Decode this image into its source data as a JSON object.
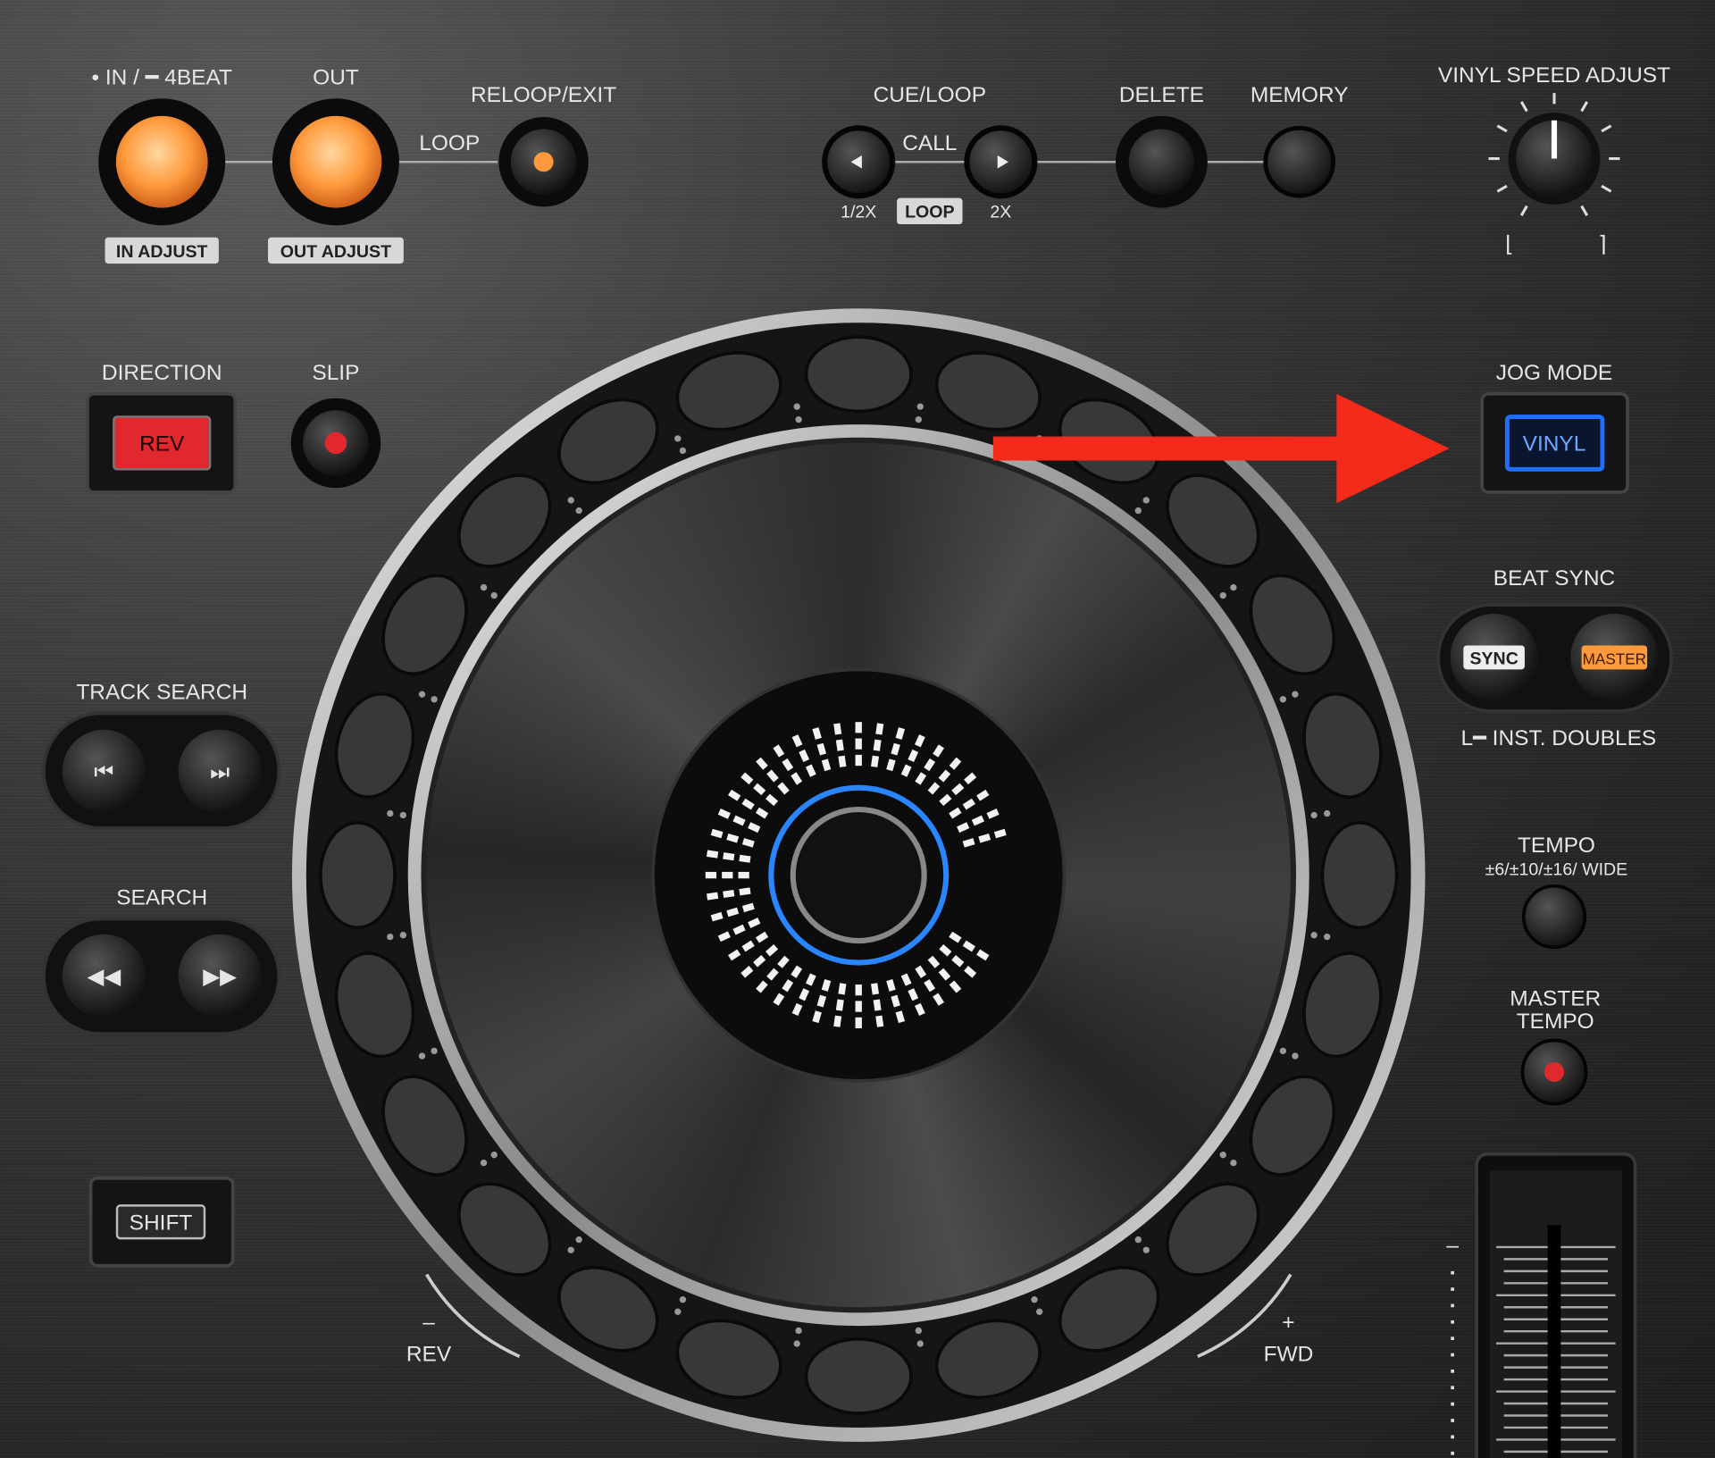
{
  "loop_section": {
    "in_label": "• IN / ━ 4BEAT",
    "out_label": "OUT",
    "reloop_label": "RELOOP/EXIT",
    "loop_label": "LOOP",
    "in_adjust": "IN ADJUST",
    "out_adjust": "OUT ADJUST"
  },
  "cue_loop": {
    "title": "CUE/LOOP",
    "call": "CALL",
    "half": "1/2X",
    "loop": "LOOP",
    "double": "2X",
    "delete": "DELETE",
    "memory": "MEMORY"
  },
  "vinyl_speed": {
    "label": "VINYL SPEED ADJUST",
    "left_symbol": "⌊",
    "right_symbol": "⌉"
  },
  "direction": {
    "label": "DIRECTION",
    "button": "REV"
  },
  "slip": {
    "label": "SLIP"
  },
  "jog_mode": {
    "label": "JOG MODE",
    "button": "VINYL"
  },
  "beat_sync": {
    "label": "BEAT SYNC",
    "sync": "SYNC",
    "master": "MASTER",
    "inst_doubles": "L━ INST. DOUBLES"
  },
  "track_search": {
    "label": "TRACK SEARCH"
  },
  "search": {
    "label": "SEARCH"
  },
  "tempo": {
    "label": "TEMPO",
    "range": "±6/±10/±16/ WIDE",
    "minus": "–"
  },
  "master_tempo": {
    "line1": "MASTER",
    "line2": "TEMPO"
  },
  "shift": {
    "label": "SHIFT"
  },
  "jog": {
    "rev_sign": "–",
    "rev": "REV",
    "fwd_sign": "+",
    "fwd": "FWD"
  },
  "colors": {
    "accent_orange": "#ff9a3c",
    "rev_red": "#e0282e",
    "vinyl_blue": "#1e6fff",
    "annotation_arrow": "#f42a1a",
    "jog_ring_blue": "#2a86ff"
  },
  "annotation": {
    "type": "arrow",
    "points_to": "jog-mode-vinyl-button"
  }
}
